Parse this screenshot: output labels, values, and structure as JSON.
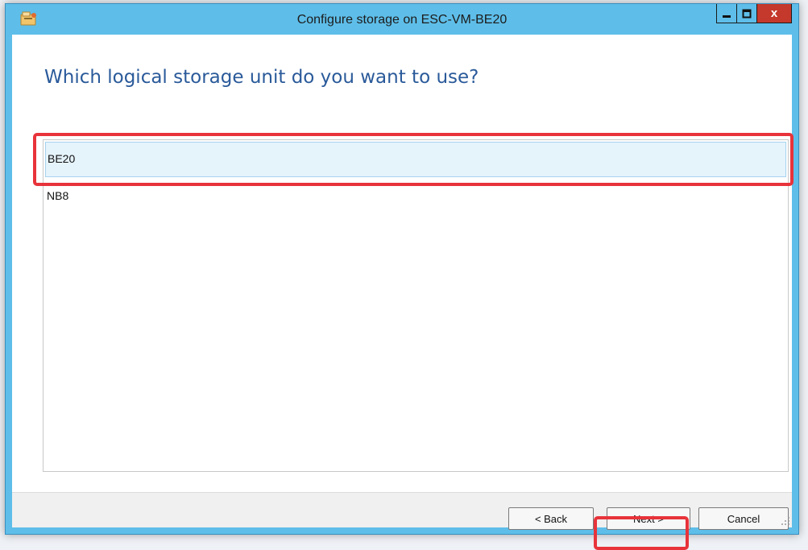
{
  "window": {
    "title": "Configure storage on ESC-VM-BE20",
    "icon": "wizard-app-icon",
    "controls": {
      "minimize": "minimize-icon",
      "maximize": "maximize-icon",
      "close_label": "x"
    }
  },
  "page": {
    "heading": "Which logical storage unit do you want to use?"
  },
  "storage_units": {
    "items": [
      {
        "label": "BE20",
        "selected": true
      },
      {
        "label": "NB8",
        "selected": false
      }
    ]
  },
  "footer": {
    "back_label": "< Back",
    "next_label": "Next >",
    "cancel_label": "Cancel"
  },
  "colors": {
    "window_frame": "#5ebee9",
    "heading": "#2a5a9a",
    "selection": "#e5f3fb",
    "annotation": "#e8333a",
    "close_button": "#c4392b"
  }
}
